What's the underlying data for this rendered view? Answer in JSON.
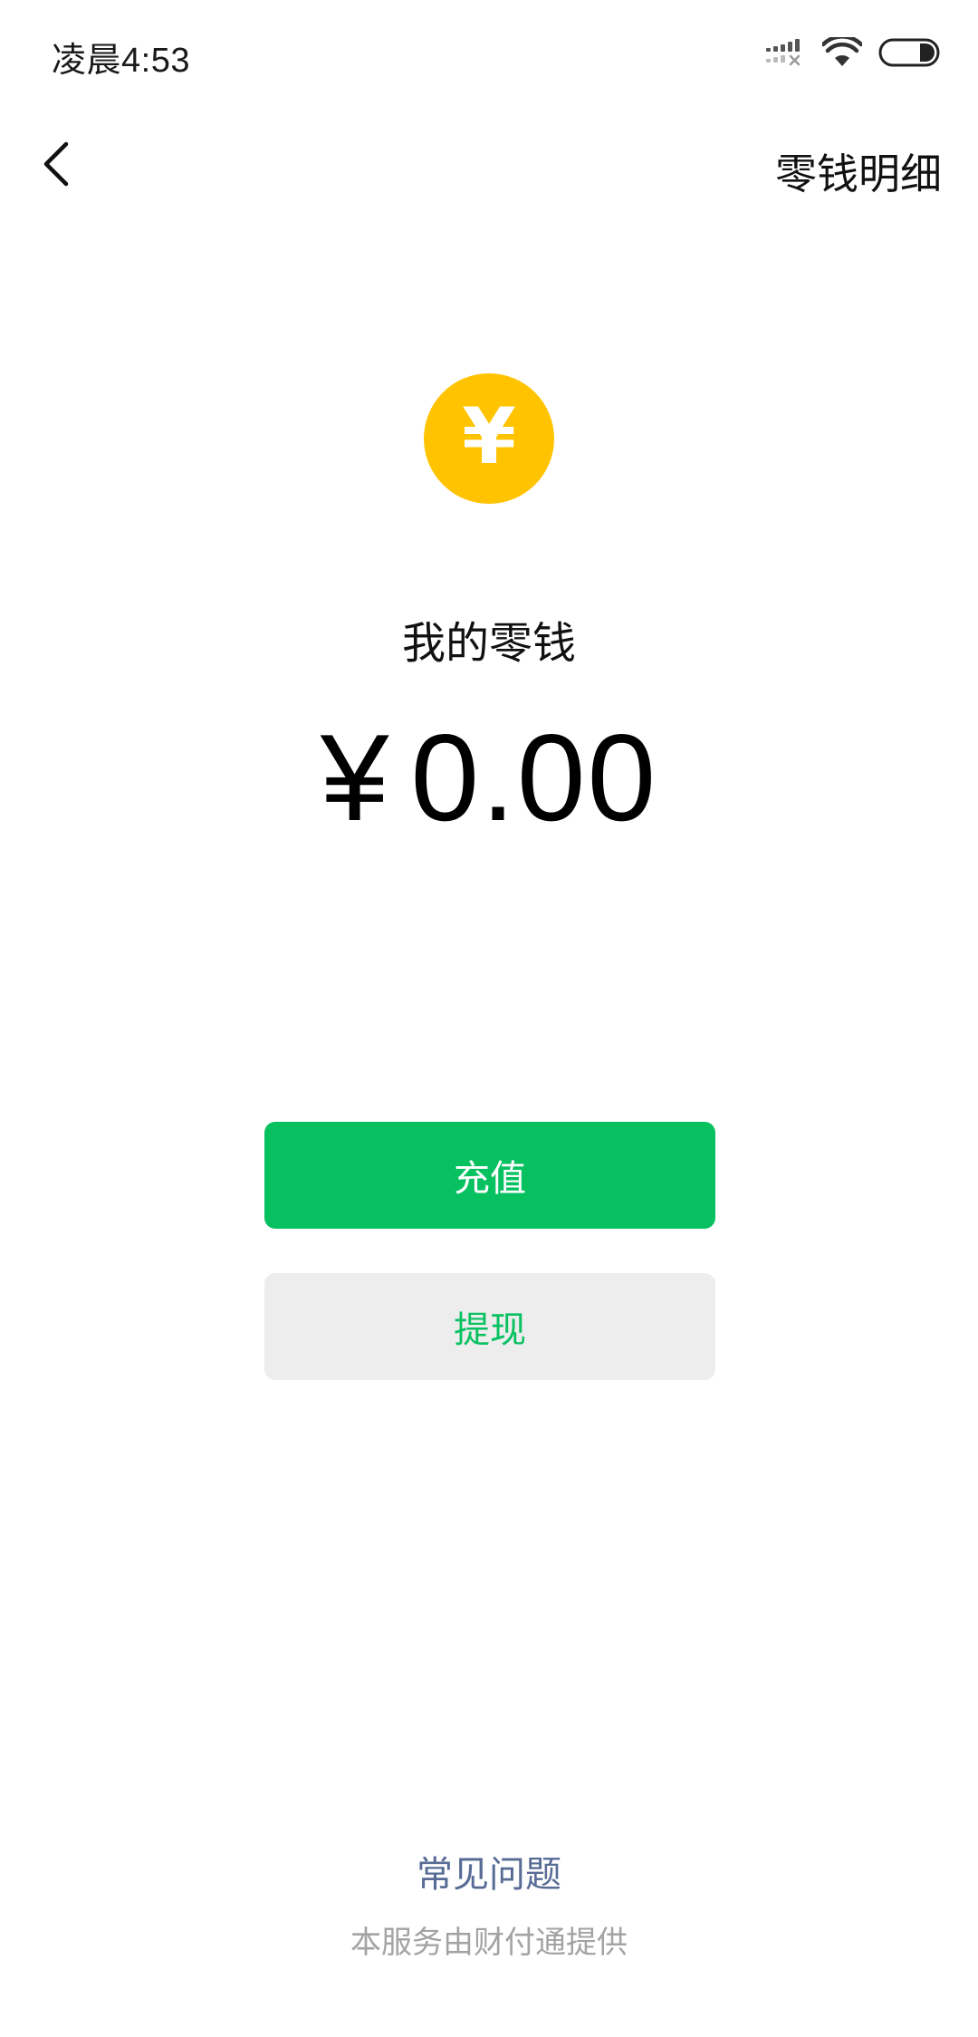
{
  "status_bar": {
    "time": "凌晨4:53",
    "icons": [
      "signal-icon",
      "wifi-icon",
      "battery-icon"
    ]
  },
  "nav": {
    "back_icon": "chevron-left-icon",
    "right_link": "零钱明细"
  },
  "wallet": {
    "coin_icon": "yen-coin-icon",
    "coin_glyph": "¥",
    "label": "我的零钱",
    "currency_symbol": "¥",
    "amount": "0.00"
  },
  "actions": {
    "recharge_label": "充值",
    "withdraw_label": "提现"
  },
  "footer": {
    "faq_label": "常见问题",
    "provider_note": "本服务由财付通提供"
  },
  "colors": {
    "primary_green": "#07C160",
    "coin_yellow": "#FFC300",
    "link_blue": "#576B95",
    "secondary_button_bg": "#EDEDED",
    "muted_text": "#A3A3A3"
  }
}
